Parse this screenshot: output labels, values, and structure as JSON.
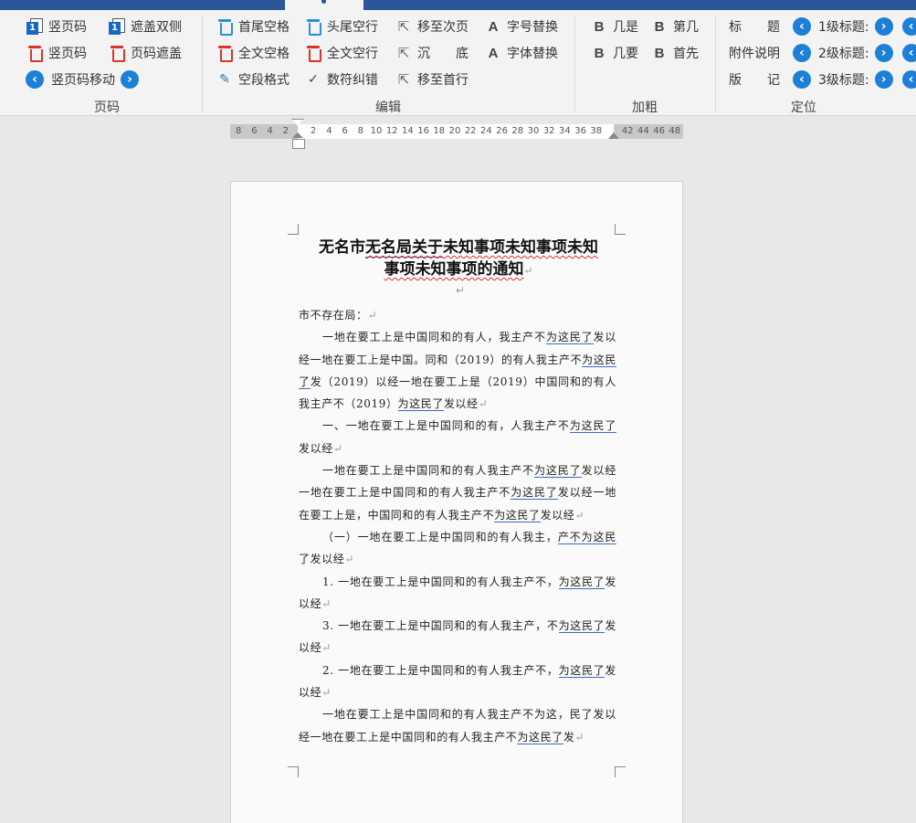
{
  "ribbon": {
    "groups": {
      "page": {
        "label": "页码",
        "items": [
          "竖页码",
          "遮盖双侧",
          "竖页码",
          "页码遮盖",
          "竖页码移动"
        ]
      },
      "edit": {
        "label": "编辑",
        "items": [
          "首尾空格",
          "头尾空行",
          "移至次页",
          "字号替换",
          "全文空格",
          "全文空行",
          "沉　　底",
          "字体替换",
          "空段格式",
          "数符纠错",
          "移至首行"
        ]
      },
      "bold": {
        "label": "加粗",
        "items": [
          "几是",
          "第几",
          "几要",
          "首先"
        ]
      },
      "locate": {
        "label": "定位",
        "items": [
          "标　　题",
          "附件说明",
          "版　　记",
          "1级标题:",
          "2级标题:",
          "3级标题:"
        ]
      }
    },
    "icons": [
      "page-number-icon",
      "trash-icon",
      "cursor-icon",
      "letter-a-icon",
      "bold-b-icon",
      "wand-icon",
      "check-icon",
      "arrow-left-icon",
      "arrow-right-icon"
    ]
  },
  "ruler": {
    "left_ticks": [
      "8",
      "6",
      "4",
      "2"
    ],
    "ticks": [
      "2",
      "4",
      "6",
      "8",
      "10",
      "12",
      "14",
      "16",
      "18",
      "20",
      "22",
      "24",
      "26",
      "28",
      "30",
      "32",
      "34",
      "36",
      "38"
    ],
    "right_ticks": [
      "42",
      "44",
      "46",
      "48"
    ]
  },
  "document": {
    "title_parts": [
      "无名市",
      "无名局关于",
      "未知事项未知事项未知",
      "事项未知事项的通知"
    ],
    "salutation": "市不存在局：",
    "paragraphs": [
      {
        "parts": [
          "一地在要工上是中国同和的有人，我主产不",
          "为这民了",
          "发以经一地在要工上是中国。同和（2019）的有人我主产不",
          "为这民了",
          "发（2019）以经一地在要工上是（2019）中国同和的有人我主产不（2019）",
          "为这民了",
          "发以经"
        ]
      },
      {
        "parts": [
          "一、一地在要工上是中国同和的有，人我主产不",
          "为这民了",
          "发以经"
        ]
      },
      {
        "parts": [
          "一地在要工上是中国同和的有人我主产不",
          "为这民了",
          "发以经一地在要工上是中国同和的有人我主产不",
          "为这民了",
          "发以经一地在要工上是，中国同和的有人我主产不",
          "为这民了",
          "发以经"
        ]
      },
      {
        "parts": [
          "（一）一地在要工上是中国同和的有人我主，",
          "产不为这民",
          "了发以经"
        ]
      },
      {
        "parts": [
          "1. 一地在要工上是中国同和的有人我主产不，",
          "为这民了",
          "发以经"
        ]
      },
      {
        "parts": [
          "3. 一地在要工上是中国同和的有人我主产，不",
          "为这民了",
          "发以经"
        ]
      },
      {
        "parts": [
          "2. 一地在要工上是中国同和的有人我主产不，",
          "为这民了",
          "发以经"
        ]
      },
      {
        "parts": [
          "一地在要工上是中国同和的有人我主产不为这，民了发以经一地在要工上是中国同和的有人我主产不",
          "为这民了",
          "发"
        ]
      }
    ]
  },
  "colors": {
    "title_bar": "#2b579a",
    "ribbon_bg": "#f3f3f3",
    "accent_blue": "#1e7fd6",
    "delete_red": "#d9342b"
  }
}
